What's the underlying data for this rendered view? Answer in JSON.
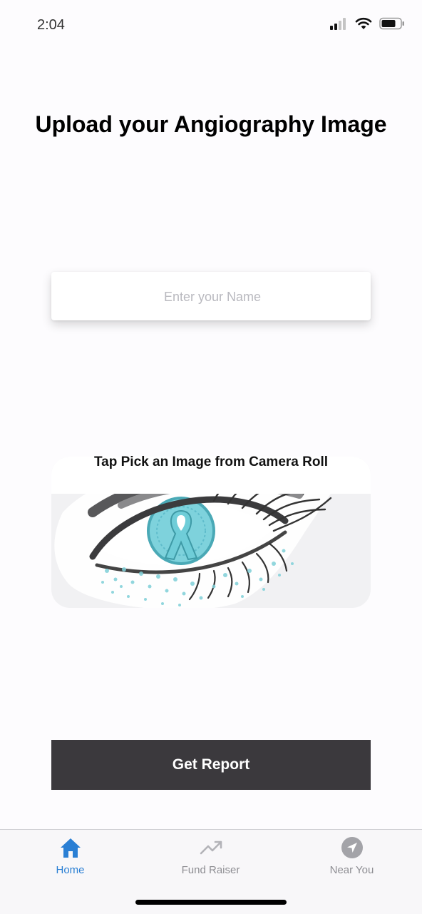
{
  "status_bar": {
    "time": "2:04"
  },
  "header": {
    "title": "Upload your Angiography Image"
  },
  "name_input": {
    "placeholder": "Enter your Name",
    "value": ""
  },
  "image_picker": {
    "caption": "Tap Pick an Image from Camera Roll"
  },
  "actions": {
    "get_report_label": "Get Report"
  },
  "tab_bar": {
    "tabs": [
      {
        "label": "Home",
        "icon": "home-icon",
        "active": true
      },
      {
        "label": "Fund Raiser",
        "icon": "trending-up-icon",
        "active": false
      },
      {
        "label": "Near You",
        "icon": "navigation-icon",
        "active": false
      }
    ]
  },
  "colors": {
    "accent": "#2a7fd4",
    "button_bg": "#3b393d",
    "ribbon": "#6fcdd8",
    "inactive_tab": "#8e8e93"
  }
}
